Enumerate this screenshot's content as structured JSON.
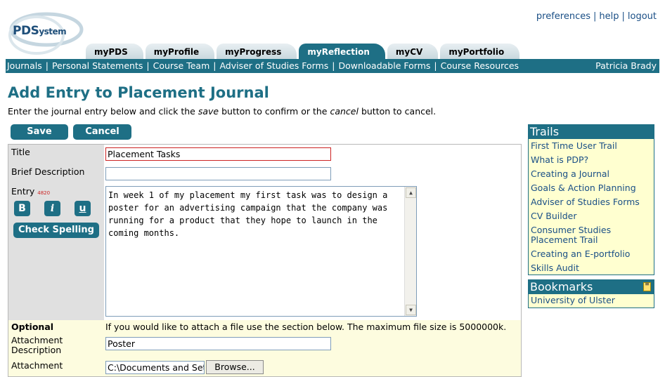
{
  "logo": {
    "main": "PDS",
    "sub": "ystem"
  },
  "toplinks": [
    "preferences",
    "help",
    "logout"
  ],
  "tabs": [
    "myPDS",
    "myProfile",
    "myProgress",
    "myReflection",
    "myCV",
    "myPortfolio"
  ],
  "active_tab": "myReflection",
  "nav": {
    "links": [
      "Journals",
      "Personal Statements",
      "Course Team",
      "Adviser of Studies Forms",
      "Downloadable Forms",
      "Course Resources"
    ],
    "user": "Patricia Brady"
  },
  "page": {
    "title": "Add Entry to Placement Journal",
    "instr_a": "Enter the journal entry below and click the ",
    "instr_save": "save",
    "instr_b": " button to confirm or the ",
    "instr_cancel": "cancel",
    "instr_c": " button to cancel."
  },
  "buttons": {
    "save": "Save",
    "cancel": "Cancel",
    "spell": "Check Spelling",
    "bold": "B",
    "italic": "i",
    "underline": "u",
    "browse": "Browse..."
  },
  "form": {
    "title_label": "Title",
    "title_value": "Placement Tasks",
    "brief_label": "Brief Description",
    "brief_value": "",
    "entry_label": "Entry",
    "entry_count": "4820",
    "entry_text": "In week 1 of my placement my first task was to design a poster for an advertising campaign that the company was running for a product that they hope to launch in the coming months.",
    "optional_label": "Optional",
    "optional_text": "If you would like to attach a file use the section below. The maximum file size is 5000000k.",
    "attach_desc_label_1": "Attachment",
    "attach_desc_label_2": "Description",
    "attach_desc_value": "Poster",
    "attach_label": "Attachment",
    "attach_value": "C:\\Documents and Setti"
  },
  "trails": {
    "heading": "Trails",
    "items": [
      "First Time User Trail",
      "What is PDP?",
      "Creating a Journal",
      "Goals & Action Planning",
      "Adviser of Studies Forms",
      "CV Builder",
      "Consumer Studies Placement Trail",
      "Creating an E-portfolio",
      "Skills Audit"
    ]
  },
  "bookmarks": {
    "heading": "Bookmarks",
    "items": [
      "University of Ulster"
    ]
  },
  "colors": {
    "brand": "#1e6f85",
    "link": "#1a4f86",
    "panel_bg": "#ffffd0",
    "required": "#cc2222"
  }
}
